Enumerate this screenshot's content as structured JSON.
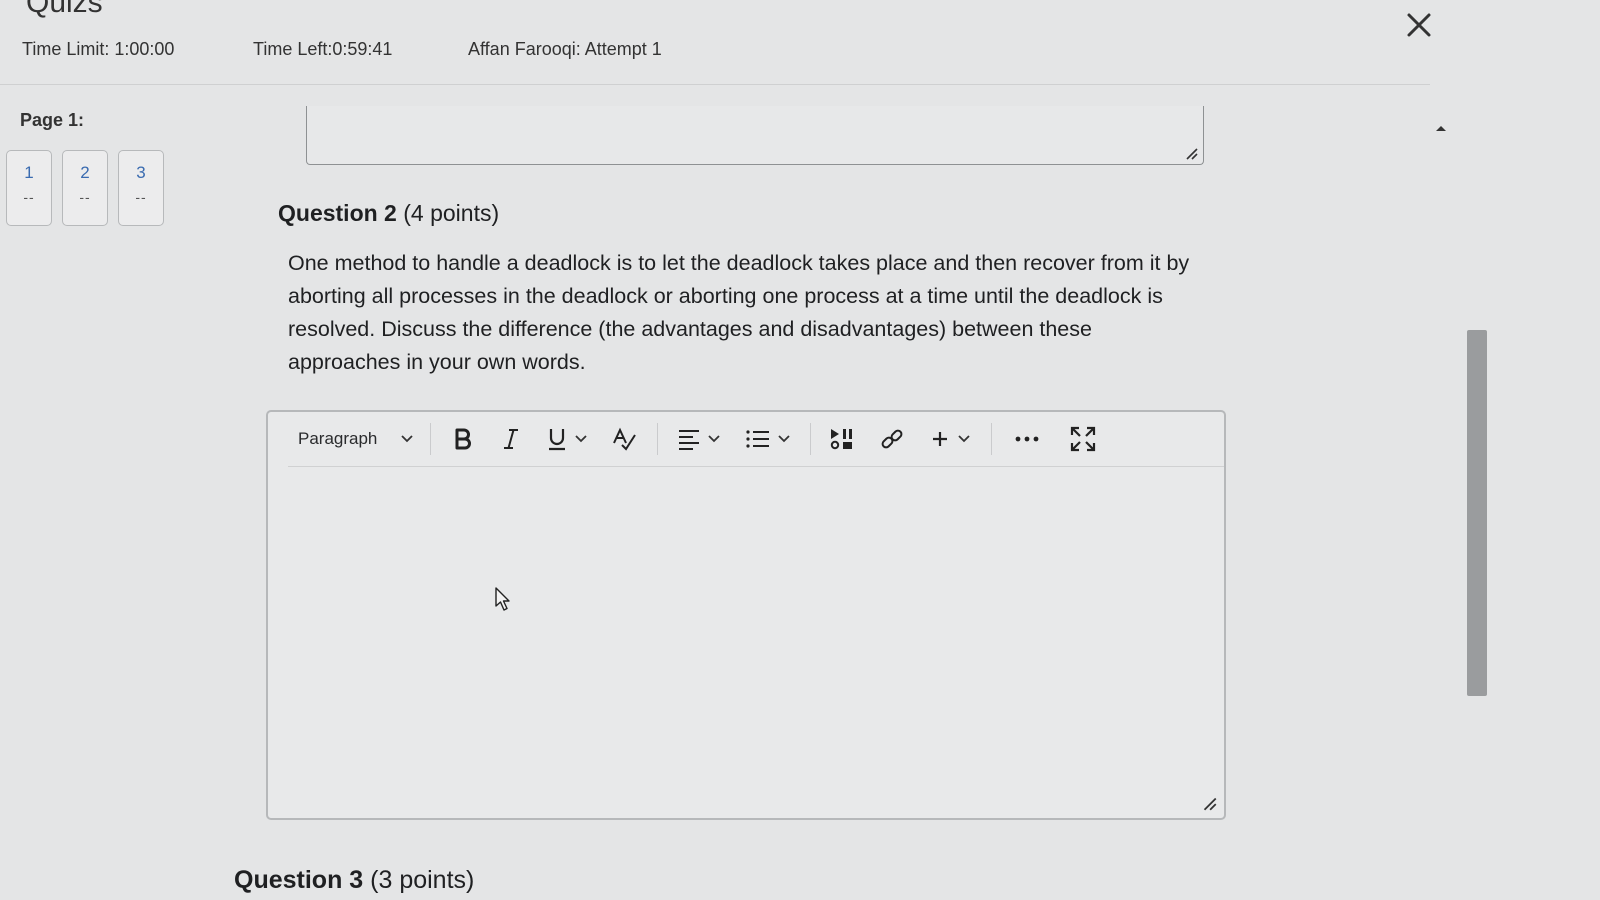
{
  "header": {
    "title": "Quizs",
    "time_limit": "Time Limit: 1:00:00",
    "time_left": "Time Left:0:59:41",
    "attempt": "Affan Farooqi: Attempt 1"
  },
  "navigation": {
    "page_label": "Page 1:",
    "pages": [
      {
        "number": "1",
        "status": "--"
      },
      {
        "number": "2",
        "status": "--"
      },
      {
        "number": "3",
        "status": "--"
      }
    ]
  },
  "question2": {
    "title": "Question 2",
    "points": "(4 points)",
    "text": "One method to handle a deadlock is to let the deadlock takes place and then recover from it by aborting all processes in the deadlock or aborting one process at a time until the deadlock is resolved. Discuss the difference (the advantages and disadvantages) between these approaches in your own words."
  },
  "editor": {
    "format_select": "Paragraph",
    "toolbar_icons": [
      "bold-icon",
      "italic-icon",
      "underline-icon",
      "spellcheck-icon",
      "align-icon",
      "list-icon",
      "media-icon",
      "link-icon",
      "insert-plus-icon",
      "more-icon",
      "fullscreen-icon"
    ],
    "content": ""
  },
  "question3": {
    "title": "Question 3",
    "points": "(3 points)"
  },
  "colors": {
    "background": "#e4e5e6",
    "page_number": "#3a6bb0",
    "border": "#b6b8ba"
  }
}
